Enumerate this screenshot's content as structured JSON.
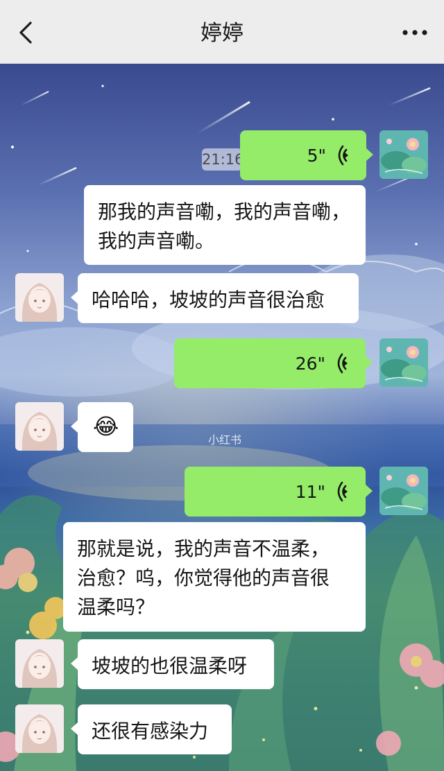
{
  "header": {
    "title": "婷婷",
    "back_icon": "chevron-left-icon",
    "more_icon": "ellipsis-icon"
  },
  "timestamp": "21:16",
  "messages": [
    {
      "from": "me",
      "type": "voice",
      "duration": "5\""
    },
    {
      "from": "me",
      "type": "text",
      "lines": [
        "那我的声音嘞，我的声音嘞，",
        "我的声音嘞。"
      ]
    },
    {
      "from": "friend",
      "type": "text",
      "lines": [
        "哈哈哈，坡坡的声音很治愈"
      ]
    },
    {
      "from": "me",
      "type": "voice",
      "duration": "26\""
    },
    {
      "from": "friend",
      "type": "emoji",
      "emoji": "😂"
    },
    {
      "from": "me",
      "type": "voice",
      "duration": "11\""
    },
    {
      "from": "me",
      "type": "text",
      "lines": [
        "那就是说，我的声音不温柔，",
        "治愈？呜，你觉得他的声音很",
        "温柔吗？"
      ]
    },
    {
      "from": "friend",
      "type": "text",
      "lines": [
        "坡坡的也很温柔呀"
      ]
    },
    {
      "from": "friend",
      "type": "text",
      "lines": [
        "还很有感染力"
      ]
    }
  ],
  "watermark": "小红书",
  "colors": {
    "my_bubble": "#95ec69",
    "friend_bubble": "#ffffff",
    "header_bg": "#ededed"
  }
}
